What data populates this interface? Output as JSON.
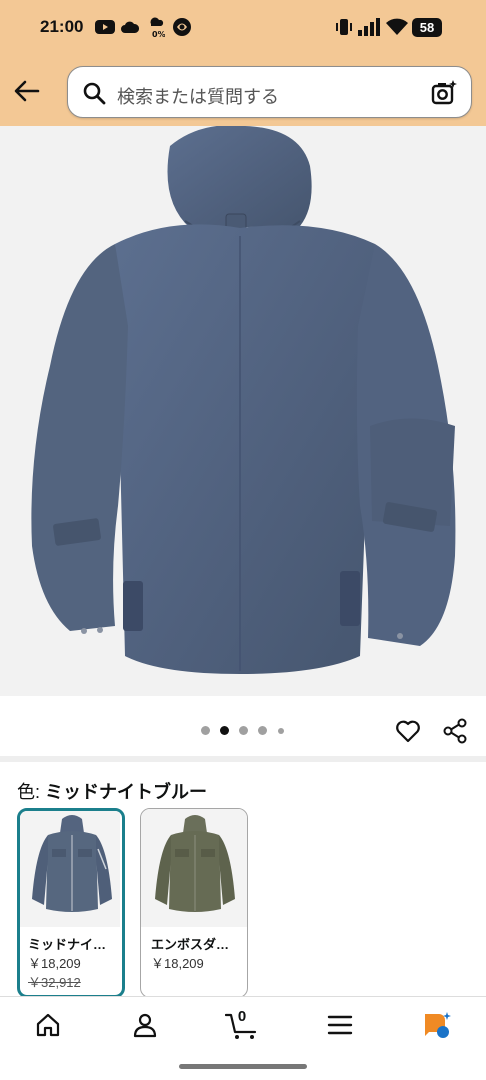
{
  "status_bar": {
    "time": "21:00",
    "battery": "58",
    "icons": [
      "youtube-icon",
      "cloud-icon",
      "weather-icon",
      "app-icon",
      "vibrate-icon",
      "signal-icon",
      "wifi-icon"
    ]
  },
  "header": {
    "background": "#f3c895",
    "search": {
      "placeholder": "検索または質問する"
    }
  },
  "gallery": {
    "page_count": 5,
    "active_index": 1
  },
  "variation": {
    "label": "色:",
    "value": "ミッドナイトブルー",
    "options": [
      {
        "name": "ミッドナイ…",
        "price": "￥18,209",
        "old_price": "￥32,912",
        "selected": true
      },
      {
        "name": "エンボスダ…",
        "price": "￥18,209",
        "selected": false
      }
    ],
    "accent": "#1b7f8c"
  },
  "tabbar": {
    "items": [
      "home-icon",
      "account-icon",
      "cart-icon",
      "menu-icon",
      "rufus-icon"
    ],
    "cart_count": "0"
  }
}
